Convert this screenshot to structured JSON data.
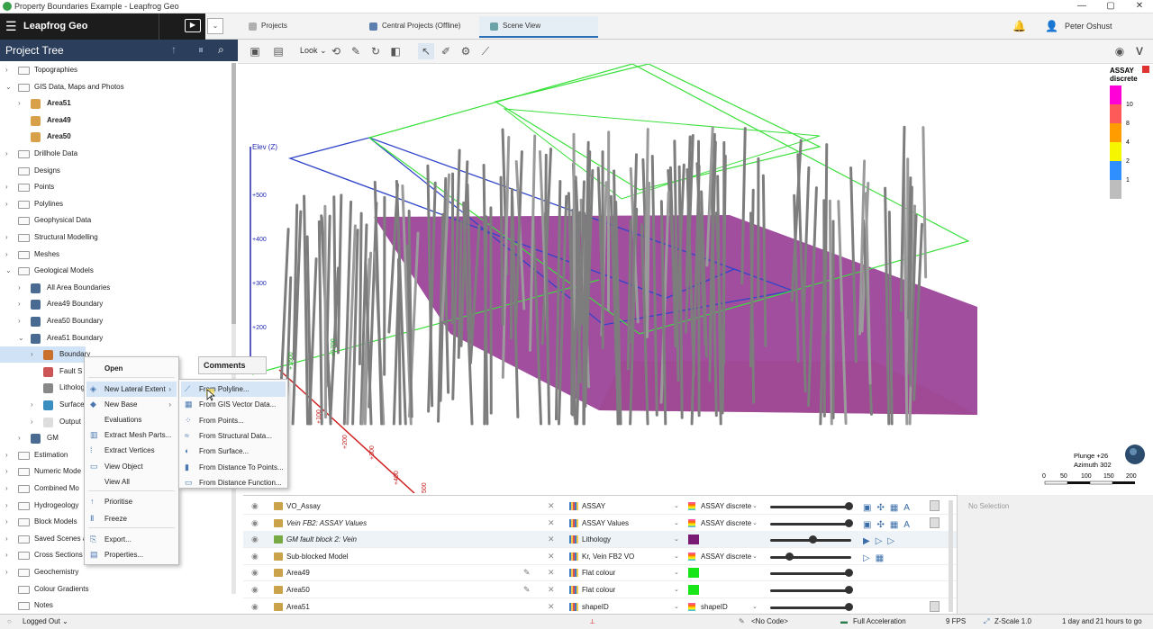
{
  "window": {
    "title": "Property Boundaries Example - Leapfrog Geo",
    "min": "—",
    "max": "▢",
    "close": "✕"
  },
  "app": {
    "name": "Leapfrog Geo",
    "menu_glyph": "☰",
    "play_glyph": "▶",
    "dropdown_glyph": "⌄"
  },
  "tabs": [
    {
      "label": "Projects",
      "active": false
    },
    {
      "label": "Central Projects (Offline)",
      "active": false
    },
    {
      "label": "Scene View",
      "active": true
    }
  ],
  "header": {
    "user": "Peter Oshust",
    "bell_icon": "🔔",
    "user_icon": "👤"
  },
  "project_tree": {
    "title": "Project Tree",
    "items": [
      {
        "label": "Topographies",
        "level": 0,
        "exp": "›"
      },
      {
        "label": "GIS Data, Maps and Photos",
        "level": 0,
        "exp": "⌄"
      },
      {
        "label": "Area51",
        "level": 1,
        "exp": "›",
        "bold": true,
        "icon": "map"
      },
      {
        "label": "Area49",
        "level": 1,
        "exp": "",
        "bold": true,
        "icon": "map"
      },
      {
        "label": "Area50",
        "level": 1,
        "exp": "",
        "bold": true,
        "icon": "map"
      },
      {
        "label": "Drillhole Data",
        "level": 0,
        "exp": "›"
      },
      {
        "label": "Designs",
        "level": 0,
        "exp": ""
      },
      {
        "label": "Points",
        "level": 0,
        "exp": "›"
      },
      {
        "label": "Polylines",
        "level": 0,
        "exp": "›"
      },
      {
        "label": "Geophysical Data",
        "level": 0,
        "exp": ""
      },
      {
        "label": "Structural Modelling",
        "level": 0,
        "exp": "›"
      },
      {
        "label": "Meshes",
        "level": 0,
        "exp": "›"
      },
      {
        "label": "Geological Models",
        "level": 0,
        "exp": "⌄"
      },
      {
        "label": "All Area Boundaries",
        "level": 1,
        "exp": "›",
        "icon": "model"
      },
      {
        "label": "Area49 Boundary",
        "level": 1,
        "exp": "›",
        "icon": "model"
      },
      {
        "label": "Area50 Boundary",
        "level": 1,
        "exp": "›",
        "icon": "model"
      },
      {
        "label": "Area51 Boundary",
        "level": 1,
        "exp": "⌄",
        "icon": "model"
      },
      {
        "label": "Boundary",
        "level": 2,
        "exp": "›",
        "icon": "boundary",
        "selected": true
      },
      {
        "label": "Fault S",
        "level": 2,
        "exp": "",
        "icon": "fault"
      },
      {
        "label": "Litholog",
        "level": 2,
        "exp": "",
        "icon": "litho"
      },
      {
        "label": "Surface",
        "level": 2,
        "exp": "›",
        "icon": "surface"
      },
      {
        "label": "Output",
        "level": 2,
        "exp": "›",
        "icon": "folder"
      },
      {
        "label": "GM",
        "level": 1,
        "exp": "›",
        "icon": "model"
      },
      {
        "label": "Estimation",
        "level": 0,
        "exp": "›"
      },
      {
        "label": "Numeric Mode",
        "level": 0,
        "exp": "›"
      },
      {
        "label": "Combined Mo",
        "level": 0,
        "exp": "›"
      },
      {
        "label": "Hydrogeology",
        "level": 0,
        "exp": "›"
      },
      {
        "label": "Block Models",
        "level": 0,
        "exp": "›"
      },
      {
        "label": "Saved Scenes a",
        "level": 0,
        "exp": "›"
      },
      {
        "label": "Cross Sections",
        "level": 0,
        "exp": "›"
      },
      {
        "label": "Geochemistry",
        "level": 0,
        "exp": "›"
      },
      {
        "label": "Colour Gradients",
        "level": 0,
        "exp": ""
      },
      {
        "label": "Notes",
        "level": 0,
        "exp": ""
      }
    ]
  },
  "toolbar": {
    "look_label": "Look",
    "look_dd": "⌄"
  },
  "scene": {
    "elev_label": "Elev (Z)",
    "elev_ticks": [
      "+500",
      "+400",
      "+300",
      "+200"
    ],
    "green_ticks": [
      "+1600",
      "+1700"
    ],
    "red_ticks": [
      "+100",
      "+200",
      "+300",
      "+400",
      "500"
    ],
    "legend": {
      "title": "ASSAY",
      "subtitle": "discrete",
      "labels": [
        "10",
        "8",
        "4",
        "2",
        "1"
      ],
      "colors": [
        "#ff00d8",
        "#ff5a5a",
        "#ff9c00",
        "#f6f600",
        "#2f8fff",
        "#bdbdbd"
      ]
    },
    "plunge": "Plunge +26",
    "azimuth": "Azimuth 302",
    "scale_labels": [
      "0",
      "50",
      "100",
      "150",
      "200"
    ]
  },
  "context_menu": {
    "items": [
      "Open",
      "New Lateral Extent",
      "New Base",
      "Evaluations",
      "Extract Mesh Parts...",
      "Extract Vertices",
      "View Object",
      "View All",
      "Prioritise",
      "Freeze",
      "Export...",
      "Properties..."
    ],
    "comments": "Comments"
  },
  "submenu": {
    "items": [
      "From Polyline...",
      "From GIS Vector Data...",
      "From Points...",
      "From Structural Data...",
      "From Surface...",
      "From Distance To Points...",
      "From Distance Function..."
    ]
  },
  "shape_list": [
    {
      "name": "VO_Assay",
      "italic": false,
      "prop": "ASSAY",
      "colour": "ASSAY discrete",
      "pen": false,
      "slider": 0.97
    },
    {
      "name": "Vein FB2: ASSAY Values",
      "italic": true,
      "prop": "ASSAY Values",
      "colour": "ASSAY discrete",
      "pen": false,
      "slider": 0.97
    },
    {
      "name": "GM fault block 2: Vein",
      "italic": true,
      "prop": "Lithology",
      "colour": "",
      "swatch": "#7b1a74",
      "pen": false,
      "slider": 0.5
    },
    {
      "name": "Sub-blocked Model",
      "italic": false,
      "prop": "Kr, Vein FB2 VO",
      "colour": "ASSAY discrete",
      "pen": false,
      "slider": 0.2
    },
    {
      "name": "Area49",
      "italic": false,
      "prop": "Flat colour",
      "colour": "",
      "swatch": "#19e619",
      "pen": true,
      "slider": 0.97
    },
    {
      "name": "Area50",
      "italic": false,
      "prop": "Flat colour",
      "colour": "",
      "swatch": "#19e619",
      "pen": true,
      "slider": 0.97
    },
    {
      "name": "Area51",
      "italic": false,
      "prop": "shapeID",
      "colour": "shapeID",
      "pen": false,
      "slider": 0.97
    }
  ],
  "selection_panel": {
    "label": "No Selection"
  },
  "status": {
    "logged": "Logged Out",
    "code": "<No Code>",
    "accel": "Full Acceleration",
    "fps": "9 FPS",
    "zscale": "Z-Scale 1.0",
    "time": "1 day and 21 hours to go"
  }
}
